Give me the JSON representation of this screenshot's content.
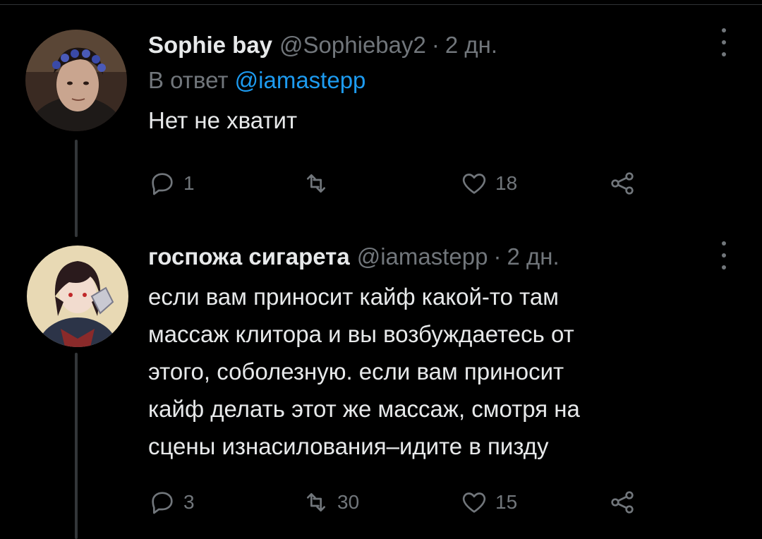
{
  "tweets": [
    {
      "author_name": "Sophie bay",
      "author_handle": "@Sophiebay2",
      "separator": "·",
      "time": "2 дн.",
      "reply_prefix": "В ответ",
      "reply_mention": "@iamastepp",
      "text": "Нет не хватит",
      "replies": "1",
      "retweets": "",
      "likes": "18"
    },
    {
      "author_name": "госпожа сигарета",
      "author_handle": "@iamastepp",
      "separator": "·",
      "time": "2 дн.",
      "text_lines": [
        "если вам приносит кайф какой-то там",
        "массаж клитора и вы возбуждаетесь от",
        "этого, соболезную. если вам приносит",
        "кайф делать этот же массаж, смотря на",
        "сцены изнасилования–идите в пизду"
      ],
      "replies": "3",
      "retweets": "30",
      "likes": "15"
    }
  ],
  "icons": {
    "reply": "reply-icon",
    "retweet": "retweet-icon",
    "like": "heart-icon",
    "share": "share-icon",
    "more": "more-vertical-icon"
  },
  "colors": {
    "background": "#000000",
    "text": "#e7e9ea",
    "secondary": "#71767b",
    "link": "#1d9bf0"
  }
}
